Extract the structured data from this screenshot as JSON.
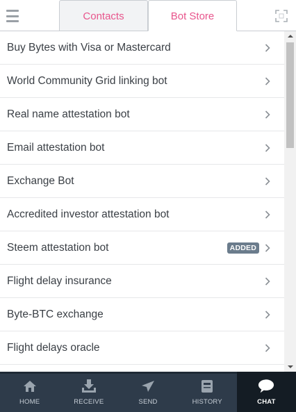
{
  "header": {
    "tabs": [
      {
        "label": "Contacts",
        "active": false
      },
      {
        "label": "Bot Store",
        "active": true
      }
    ],
    "accent_color": "#e8558c"
  },
  "bots": [
    {
      "label": "Buy Bytes with Visa or Mastercard"
    },
    {
      "label": "World Community Grid linking bot"
    },
    {
      "label": "Real name attestation bot"
    },
    {
      "label": "Email attestation bot"
    },
    {
      "label": "Exchange Bot"
    },
    {
      "label": "Accredited investor attestation bot"
    },
    {
      "label": "Steem attestation bot",
      "badge": "ADDED"
    },
    {
      "label": "Flight delay insurance"
    },
    {
      "label": "Byte-BTC exchange"
    },
    {
      "label": "Flight delays oracle"
    },
    {
      "label": ""
    }
  ],
  "nav": {
    "items": [
      {
        "label": "HOME",
        "icon": "home-icon"
      },
      {
        "label": "RECEIVE",
        "icon": "receive-icon"
      },
      {
        "label": "SEND",
        "icon": "send-icon"
      },
      {
        "label": "HISTORY",
        "icon": "history-icon"
      },
      {
        "label": "CHAT",
        "icon": "chat-icon",
        "active": true
      }
    ]
  }
}
